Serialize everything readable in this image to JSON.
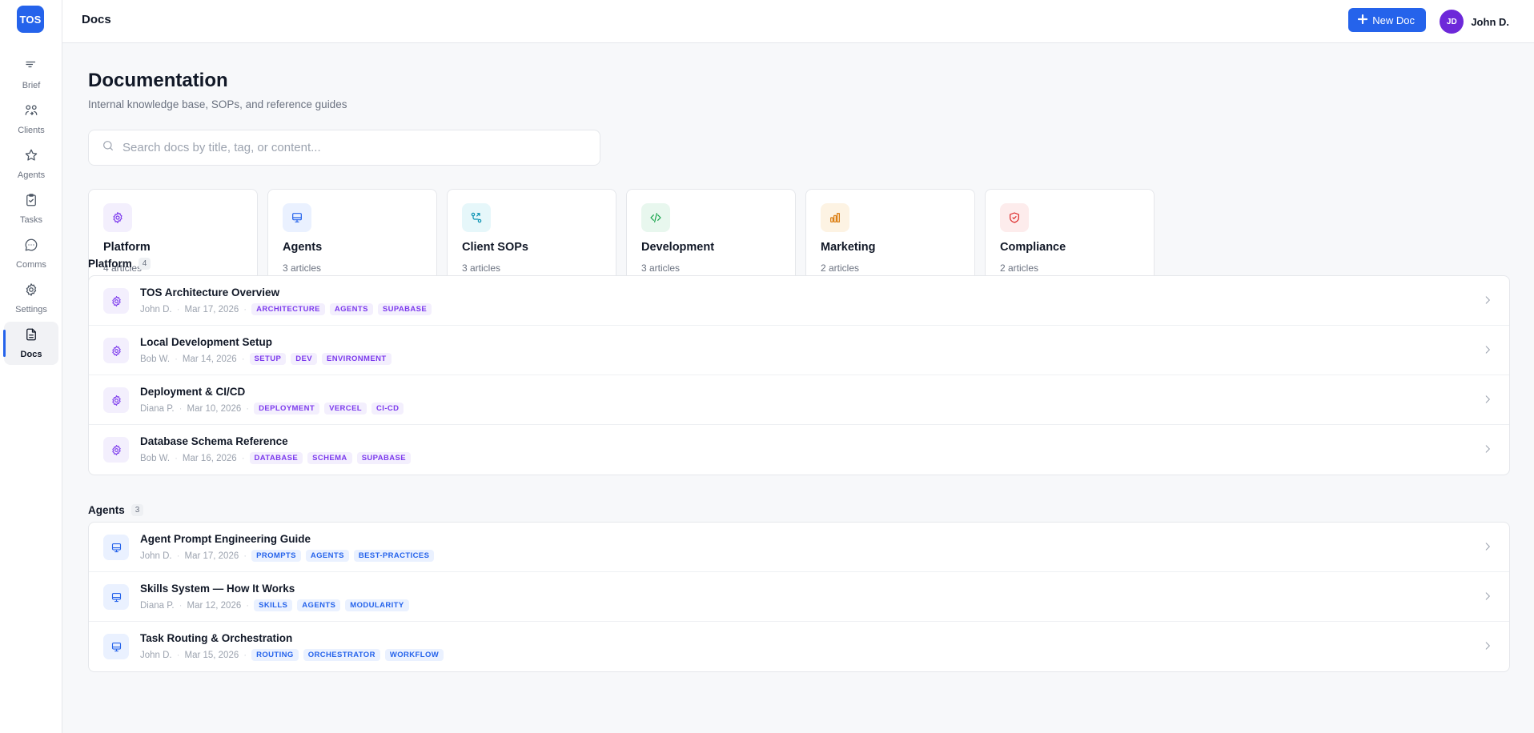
{
  "app": {
    "logo": "TOS"
  },
  "sidebar": {
    "items": [
      {
        "label": "Brief",
        "icon": "brief-icon"
      },
      {
        "label": "Clients",
        "icon": "clients-icon"
      },
      {
        "label": "Agents",
        "icon": "star-icon"
      },
      {
        "label": "Tasks",
        "icon": "clipboard-icon"
      },
      {
        "label": "Comms",
        "icon": "chat-icon"
      },
      {
        "label": "Settings",
        "icon": "gear-icon"
      },
      {
        "label": "Docs",
        "icon": "document-icon",
        "active": true
      }
    ]
  },
  "topbar": {
    "title": "Docs",
    "new_doc_label": "New Doc",
    "user": {
      "initials": "JD",
      "name": "John D."
    }
  },
  "page": {
    "title": "Documentation",
    "subtitle": "Internal knowledge base, SOPs, and reference guides",
    "search_placeholder": "Search docs by title, tag, or content..."
  },
  "categories": [
    {
      "name": "Platform",
      "count": "4 articles",
      "icon": "gear-icon",
      "color": "#7c3aed",
      "bg": "#f3effd"
    },
    {
      "name": "Agents",
      "count": "3 articles",
      "icon": "monitor-icon",
      "color": "#2563eb",
      "bg": "#eaf1ff"
    },
    {
      "name": "Client SOPs",
      "count": "3 articles",
      "icon": "workflow-icon",
      "color": "#0891b2",
      "bg": "#e6f7fa"
    },
    {
      "name": "Development",
      "count": "3 articles",
      "icon": "code-icon",
      "color": "#16a34a",
      "bg": "#e8f7ee"
    },
    {
      "name": "Marketing",
      "count": "2 articles",
      "icon": "chart-icon",
      "color": "#d97706",
      "bg": "#fdf3e3"
    },
    {
      "name": "Compliance",
      "count": "2 articles",
      "icon": "shield-icon",
      "color": "#dc2626",
      "bg": "#fdecec"
    }
  ],
  "sections": [
    {
      "title": "Platform",
      "count": "4",
      "color": "purple",
      "docs": [
        {
          "title": "TOS Architecture Overview",
          "author": "John D.",
          "date": "Mar 17, 2026",
          "tags": [
            "ARCHITECTURE",
            "AGENTS",
            "SUPABASE"
          ]
        },
        {
          "title": "Local Development Setup",
          "author": "Bob W.",
          "date": "Mar 14, 2026",
          "tags": [
            "SETUP",
            "DEV",
            "ENVIRONMENT"
          ]
        },
        {
          "title": "Deployment & CI/CD",
          "author": "Diana P.",
          "date": "Mar 10, 2026",
          "tags": [
            "DEPLOYMENT",
            "VERCEL",
            "CI-CD"
          ]
        },
        {
          "title": "Database Schema Reference",
          "author": "Bob W.",
          "date": "Mar 16, 2026",
          "tags": [
            "DATABASE",
            "SCHEMA",
            "SUPABASE"
          ]
        }
      ]
    },
    {
      "title": "Agents",
      "count": "3",
      "color": "blue",
      "docs": [
        {
          "title": "Agent Prompt Engineering Guide",
          "author": "John D.",
          "date": "Mar 17, 2026",
          "tags": [
            "PROMPTS",
            "AGENTS",
            "BEST-PRACTICES"
          ]
        },
        {
          "title": "Skills System — How It Works",
          "author": "Diana P.",
          "date": "Mar 12, 2026",
          "tags": [
            "SKILLS",
            "AGENTS",
            "MODULARITY"
          ]
        },
        {
          "title": "Task Routing & Orchestration",
          "author": "John D.",
          "date": "Mar 15, 2026",
          "tags": [
            "ROUTING",
            "ORCHESTRATOR",
            "WORKFLOW"
          ]
        }
      ]
    }
  ]
}
